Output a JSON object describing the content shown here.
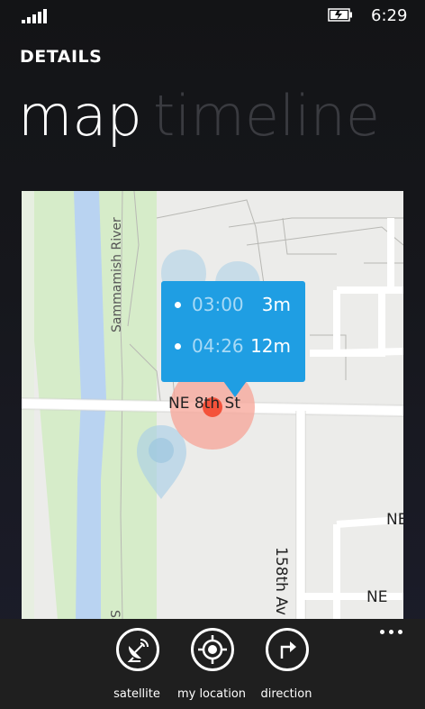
{
  "status_bar": {
    "time": "6:29",
    "signal_icon": "signal-bars-icon",
    "battery_icon": "battery-charging-icon"
  },
  "header": {
    "app_title": "DETAILS"
  },
  "pivot": {
    "tabs": [
      {
        "label": "map",
        "active": true
      },
      {
        "label": "timeline",
        "active": false
      }
    ]
  },
  "map": {
    "street_labels": {
      "ne_street": "NE 8th St",
      "avenue": "158th Av",
      "river": "Sammamish River",
      "river_bottom": "Sam",
      "ne_right1": "NE",
      "ne_right2": "NE"
    },
    "popup": {
      "entries": [
        {
          "time": "03:00",
          "duration": "3m"
        },
        {
          "time": "04:26",
          "duration": "12m"
        }
      ]
    },
    "colors": {
      "popup": "#1f9ee3",
      "current_marker": "#f4523a",
      "accuracy_circle": "#f7a497",
      "river": "#b9d3f1",
      "park": "#d6ecc9",
      "past_marker": "#aacfe6"
    }
  },
  "app_bar": {
    "buttons": [
      {
        "label": "satellite",
        "icon": "satellite-dish-icon"
      },
      {
        "label": "my location",
        "icon": "location-target-icon"
      },
      {
        "label": "direction",
        "icon": "direction-arrow-icon"
      }
    ],
    "more_icon": "more-ellipsis-icon"
  }
}
